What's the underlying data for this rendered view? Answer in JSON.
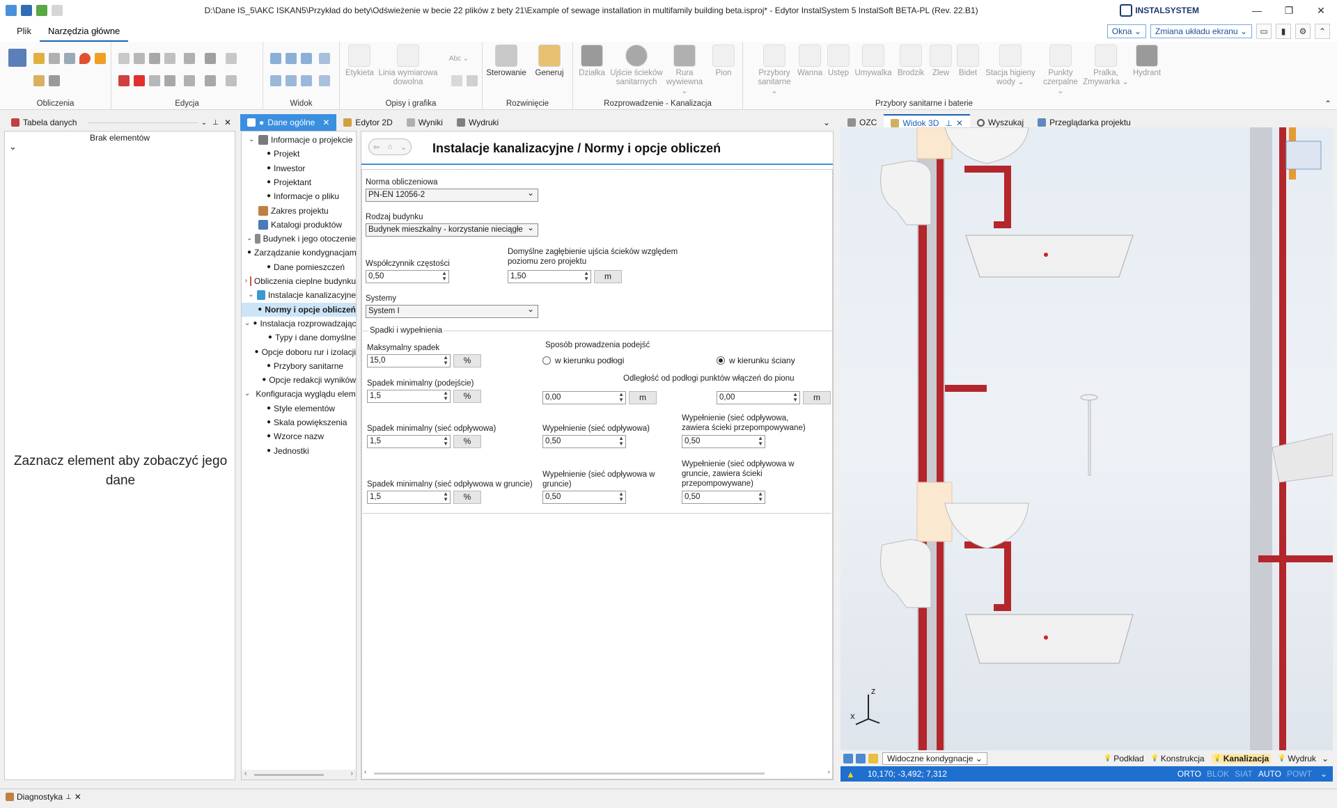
{
  "window": {
    "title": "D:\\Dane IS_5\\AKC ISKAN5\\Przykład do bety\\Odświeżenie w becie 22 plików z bety 21\\Example of sewage installation in multifamily building beta.isproj* - Edytor InstalSystem 5 InstalSoft BETA-PL (Rev. 22.B1)",
    "logo_text": "INSTALSYSTEM",
    "minimize": "—",
    "restore": "❐",
    "close": "✕"
  },
  "menu": {
    "tabs": [
      "Plik",
      "Narzędzia główne"
    ],
    "active_tab": "Narzędzia główne",
    "okna_label": "Okna",
    "layout_label": "Zmiana układu ekranu",
    "collapse_arrow": "⌃"
  },
  "ribbon": {
    "groups": {
      "obliczenia": "Obliczenia",
      "edycja": "Edycja",
      "widok": "Widok",
      "opisy": "Opisy i grafika",
      "rozwiniecie": "Rozwinięcie",
      "rozprowadzenie": "Rozprowadzenie - Kanalizacja",
      "przybory": "Przybory sanitarne i baterie"
    },
    "buttons": {
      "etykieta": "Etykieta",
      "linia": "Linia wymiarowa dowolna",
      "abc": "Abc",
      "sterowanie": "Sterowanie",
      "generuj": "Generuj",
      "dzialka": "Działka",
      "ujscie": "Ujście ścieków sanitarnych",
      "rura": "Rura wywiewna",
      "pion": "Pion",
      "przybory_san": "Przybory sanitarne",
      "wanna": "Wanna",
      "ustep": "Ustęp",
      "umywalka": "Umywalka",
      "brodzik": "Brodzik",
      "zlew": "Zlew",
      "bidet": "Bidet",
      "stacja": "Stacja higieny wody",
      "punkty": "Punkty czerpalne",
      "pralka": "Pralka, Zmywarka",
      "hydrant": "Hydrant"
    }
  },
  "left_panel": {
    "tab": "Tabela danych",
    "header": "Brak elementów",
    "chevron": "⌄",
    "placeholder": "Zaznacz element aby zobaczyć jego dane"
  },
  "doc_tabs": [
    "Dane ogólne",
    "Edytor 2D",
    "Wyniki",
    "Wydruki"
  ],
  "doc_tab_bullet": "●",
  "tree": [
    {
      "label": "Informacje o projekcie",
      "level": 0,
      "expander": "⌄"
    },
    {
      "label": "Projekt",
      "level": 1
    },
    {
      "label": "Inwestor",
      "level": 1
    },
    {
      "label": "Projektant",
      "level": 1
    },
    {
      "label": "Informacje o pliku",
      "level": 1
    },
    {
      "label": "Zakres projektu",
      "level": 0
    },
    {
      "label": "Katalogi produktów",
      "level": 0
    },
    {
      "label": "Budynek i jego otoczenie",
      "level": 0,
      "expander": "⌄"
    },
    {
      "label": "Zarządzanie kondygnacjami",
      "level": 1
    },
    {
      "label": "Dane pomieszczeń",
      "level": 1
    },
    {
      "label": "Obliczenia cieplne budynku",
      "level": 0,
      "expander": "›"
    },
    {
      "label": "Instalacje kanalizacyjne",
      "level": 0,
      "expander": "⌄"
    },
    {
      "label": "Normy i opcje obliczeń",
      "level": 1,
      "selected": true
    },
    {
      "label": "Instalacja rozprowadzająca",
      "level": 1,
      "expander": "⌄"
    },
    {
      "label": "Typy i dane domyślne",
      "level": 2
    },
    {
      "label": "Opcje doboru rur i izolacji",
      "level": 1
    },
    {
      "label": "Przybory sanitarne",
      "level": 1
    },
    {
      "label": "Opcje redakcji wyników",
      "level": 1
    },
    {
      "label": "Konfiguracja wyglądu elementów",
      "level": 0,
      "expander": "⌄"
    },
    {
      "label": "Style elementów",
      "level": 1
    },
    {
      "label": "Skala powiększenia",
      "level": 1
    },
    {
      "label": "Wzorce nazw",
      "level": 1
    },
    {
      "label": "Jednostki",
      "level": 1
    }
  ],
  "form": {
    "title": "Instalacje kanalizacyjne / Normy i opcje obliczeń",
    "norma_label": "Norma obliczeniowa",
    "norma_value": "PN-EN 12056-2",
    "budynek_label": "Rodzaj budynku",
    "budynek_value": "Budynek mieszkalny - korzystanie nieciągłe",
    "wsp_label": "Współczynnik częstości",
    "wsp_value": "0,50",
    "zaglebienie_label": "Domyślne zagłębienie ujścia ścieków względem poziomu zero projektu",
    "zaglebienie_value": "1,50",
    "systemy_label": "Systemy",
    "systemy_value": "System I",
    "spadki_section": "Spadki i wypełnienia",
    "max_spadek_label": "Maksymalny spadek",
    "max_spadek_value": "15,0",
    "sposob_label": "Sposób prowadzenia podejść",
    "radio_podlogi": "w kierunku podłogi",
    "radio_sciany": "w kierunku ściany",
    "spadek_podejscie_label": "Spadek minimalny (podejście)",
    "spadek_podejscie_value": "1,5",
    "odleglosc_label": "Odległość od podłogi punktów włączeń do pionu",
    "odleglosc_1": "0,00",
    "odleglosc_2": "0,00",
    "spadek_odplywowa_label": "Spadek minimalny (sieć odpływowa)",
    "spadek_odplywowa_value": "1,5",
    "wyp_odplywowa_label": "Wypełnienie (sieć odpływowa)",
    "wyp_odplywowa_value": "0,50",
    "wyp_przepomp_label": "Wypełnienie (sieć odpływowa, zawiera ścieki przepompowywane)",
    "wyp_przepomp_value": "0,50",
    "spadek_grunt_label": "Spadek minimalny (sieć odpływowa w gruncie)",
    "spadek_grunt_value": "1,5",
    "wyp_grunt_label": "Wypełnienie (sieć odpływowa w gruncie)",
    "wyp_grunt_value": "0,50",
    "wyp_grunt_przepomp_label": "Wypełnienie (sieć odpływowa w gruncie, zawiera ścieki przepompowywane)",
    "wyp_grunt_przepomp_value": "0,50",
    "unit_m": "m",
    "unit_pct": "%"
  },
  "right_tabs": [
    "OZC",
    "Widok 3D",
    "Wyszukaj",
    "Przeglądarka projektu"
  ],
  "view3d": {
    "visible_storeys": "Widoczne kondygnacje",
    "layers": [
      "Podkład",
      "Konstrukcja",
      "Kanalizacja",
      "Wydruk"
    ],
    "active_layer": "Kanalizacja",
    "coords": "10,170; -3,492; 7,312",
    "status_flags": [
      "ORTO",
      "BLOK",
      "SIAT",
      "AUTO",
      "POWT"
    ],
    "active_flags": [
      "ORTO",
      "AUTO"
    ],
    "axis_z": "Z",
    "axis_x": "X"
  },
  "bottom": {
    "diagnostyka": "Diagnostyka"
  },
  "colors": {
    "accent": "#3b8fe0",
    "status_blue": "#1f6fd0",
    "pipe_red": "#b3262b"
  }
}
